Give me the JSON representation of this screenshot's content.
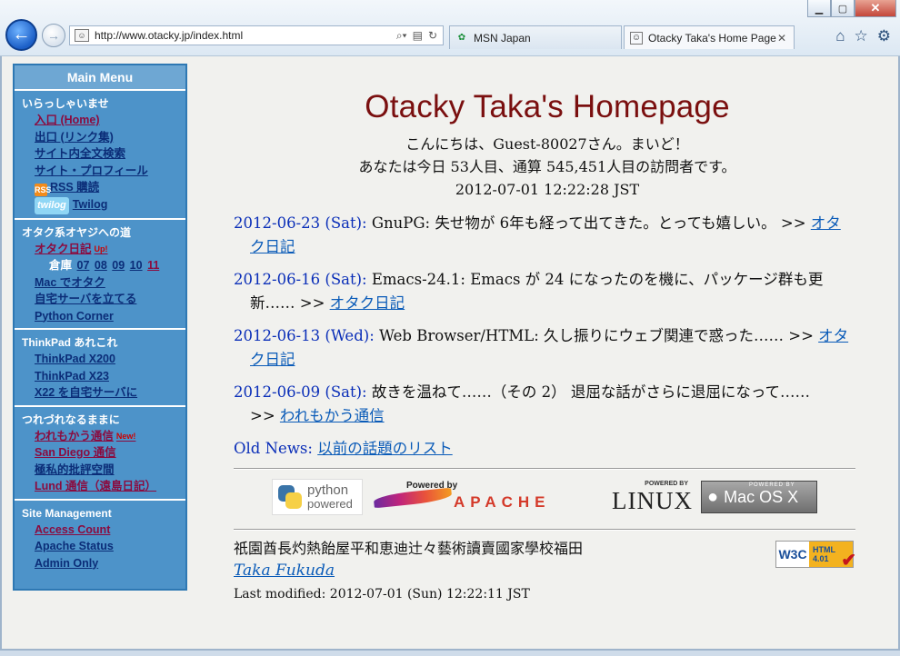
{
  "browser": {
    "address": "http://www.otacky.jp/index.html",
    "tabs": [
      {
        "label": "MSN Japan"
      },
      {
        "label": "Otacky Taka's Home Page"
      }
    ]
  },
  "menu": {
    "title": "Main Menu",
    "sections": [
      {
        "heading": "いらっしゃいませ",
        "items": [
          "入口 (Home)",
          "出口 (リンク集)",
          "サイト内全文検索",
          "サイト・プロフィール",
          "RSS 購読",
          "Twilog"
        ],
        "rss_logo": "RSS",
        "twilog_logo": "twilog"
      },
      {
        "heading": "オタク系オヤジへの道",
        "items": [
          "オタク日記",
          "Mac でオタク",
          "自宅サーバを立てる",
          "Python Corner"
        ],
        "badge": "Up!",
        "archive_label": "倉庫",
        "archive": [
          "07",
          "08",
          "09",
          "10",
          "11"
        ]
      },
      {
        "heading": "ThinkPad あれこれ",
        "items": [
          "ThinkPad X200",
          "ThinkPad X23",
          "X22 を自宅サーバに"
        ]
      },
      {
        "heading": "つれづれなるままに",
        "items": [
          "われもかう通信",
          "San Diego 通信",
          "極私的批評空間",
          "Lund 通信（遠島日記）"
        ],
        "badge": "New!"
      },
      {
        "heading": "Site Management",
        "items": [
          "Access Count",
          "Apache Status",
          "Admin Only"
        ]
      }
    ]
  },
  "main": {
    "title": "Otacky Taka's Homepage",
    "greeting": [
      "こんにちは、Guest-80027さん。まいど！",
      "あなたは今日 53人目、通算 545,451人目の訪問者です。",
      "2012-07-01 12:22:28 JST"
    ],
    "news": [
      {
        "date": "2012-06-23 (Sat):",
        "text": " GnuPG: 失せ物が 6年も経って出てきた。とっても嬉しい。 >> ",
        "link": "オタク日記"
      },
      {
        "date": "2012-06-16 (Sat):",
        "text": " Emacs-24.1: Emacs が 24 になったのを機に、パッケージ群も更新…… >> ",
        "link": "オタク日記"
      },
      {
        "date": "2012-06-13 (Wed):",
        "text": " Web Browser/HTML: 久し振りにウェブ関連で惑った…… >> ",
        "link": "オタク日記"
      },
      {
        "date": "2012-06-09 (Sat):",
        "text": " 故きを温ねて……（その 2） 退屈な話がさらに退屈になって…… >> ",
        "link": "われもかう通信"
      }
    ],
    "old_news_label": "Old News:",
    "old_news_link": "以前の話題のリスト",
    "badges": {
      "python_line1": "python",
      "python_line2": "powered",
      "apache_powered": "Powered by",
      "apache_word": "APACHE",
      "linux_powered": "POWERED BY",
      "linux_word": "LINUX",
      "mac_powered": "POWERED BY",
      "mac_word": "Mac OS X"
    },
    "footer": {
      "kanji": "祇園酋長灼熱飴屋平和恵迪辻々藝術讀賣國家學校福田",
      "author": "Taka Fukuda",
      "modified": "Last modified: 2012-07-01 (Sun) 12:22:11 JST",
      "w3c_left": "W3C",
      "w3c_html": "HTML",
      "w3c_version": "4.01"
    }
  }
}
